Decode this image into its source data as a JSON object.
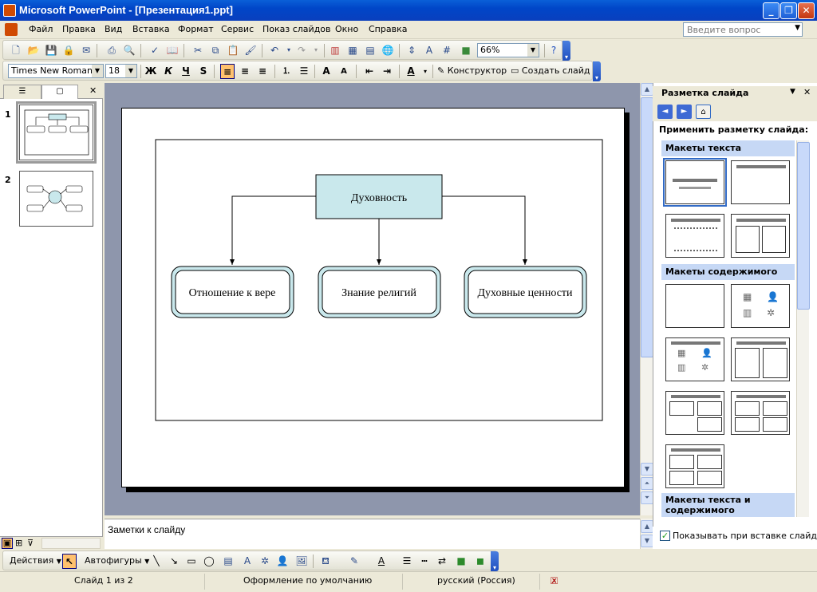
{
  "window": {
    "title": "Microsoft PowerPoint - [Презентация1.ppt]"
  },
  "menu": {
    "items": [
      "Файл",
      "Правка",
      "Вид",
      "Вставка",
      "Формат",
      "Сервис",
      "Показ слайдов",
      "Окно",
      "Справка"
    ],
    "help_placeholder": "Введите вопрос"
  },
  "standard_toolbar": {
    "zoom": "66%"
  },
  "format_toolbar": {
    "font": "Times New Roman",
    "size": "18",
    "bold": "Ж",
    "italic": "К",
    "underline": "Ч",
    "shadow": "S",
    "designer": "Конструктор",
    "new_slide": "Создать слайд"
  },
  "slide": {
    "root": "Духовность",
    "children": [
      "Отношение к вере",
      "Знание религий",
      "Духовные ценности"
    ]
  },
  "thumbnails": [
    "1",
    "2"
  ],
  "notes_placeholder": "Заметки к слайду",
  "task_pane": {
    "title": "Разметка слайда",
    "apply_label": "Применить разметку слайда:",
    "sections": [
      "Макеты текста",
      "Макеты содержимого",
      "Макеты текста и содержимого"
    ],
    "show_on_insert": "Показывать при вставке слайдов"
  },
  "drawing_toolbar": {
    "actions": "Действия",
    "autoshapes": "Автофигуры"
  },
  "status": {
    "slide": "Слайд 1 из 2",
    "design": "Оформление по умолчанию",
    "language": "русский (Россия)"
  },
  "colors": {
    "accent": "#316ac5",
    "root_fill": "#c9e8ec",
    "child_fill": "#ffffff",
    "child_border": "#7fb0b6"
  }
}
